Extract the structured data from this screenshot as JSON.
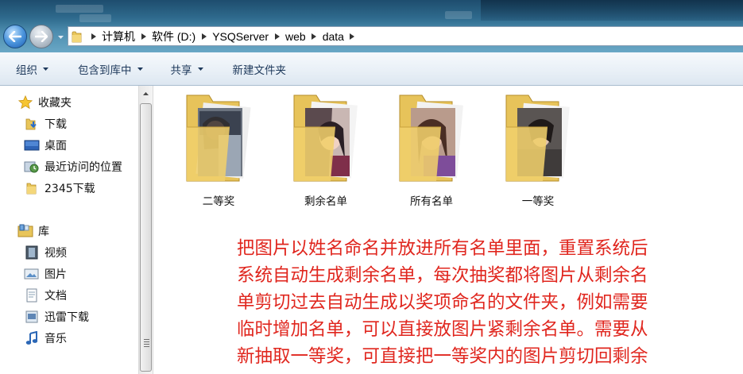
{
  "address": {
    "breadcrumbs": [
      "计算机",
      "软件 (D:)",
      "YSQServer",
      "web",
      "data"
    ]
  },
  "toolbar": {
    "organize": "组织",
    "include_in_library": "包含到库中",
    "share": "共享",
    "new_folder": "新建文件夹"
  },
  "sidebar": {
    "favorites_header": "收藏夹",
    "favorites": [
      "下载",
      "桌面",
      "最近访问的位置",
      "2345下载"
    ],
    "libraries_header": "库",
    "libraries": [
      "视频",
      "图片",
      "文档",
      "迅雷下载",
      "音乐"
    ]
  },
  "folders": [
    "二等奖",
    "剩余名单",
    "所有名单",
    "一等奖"
  ],
  "note": {
    "lines": [
      "把图片以姓名命名并放进所有名单里面，重置系统后",
      "系统自动生成剩余名单，每次抽奖都将图片从剩余名",
      "单剪切过去自动生成以奖项命名的文件夹，例如需要",
      "临时增加名单，可以直接放图片紧剩余名单。需要从",
      "新抽取一等奖，可直接把一等奖内的图片剪切回剩余"
    ],
    "color": "#e0261e"
  },
  "colors": {
    "titlebar": "#2f6b8e",
    "toolbar_text": "#1e395b",
    "folder_yellow": "#e8c55a"
  },
  "icons": {
    "back": "back-arrow-icon",
    "forward": "forward-arrow-icon",
    "favorites": "star-icon",
    "download": "download-folder-icon",
    "desktop": "desktop-icon",
    "recent": "recent-places-icon",
    "folder": "folder-icon",
    "library": "library-icon",
    "video": "video-library-icon",
    "pictures": "pictures-library-icon",
    "documents": "documents-library-icon",
    "thunder": "thunder-download-icon",
    "music": "music-library-icon"
  }
}
